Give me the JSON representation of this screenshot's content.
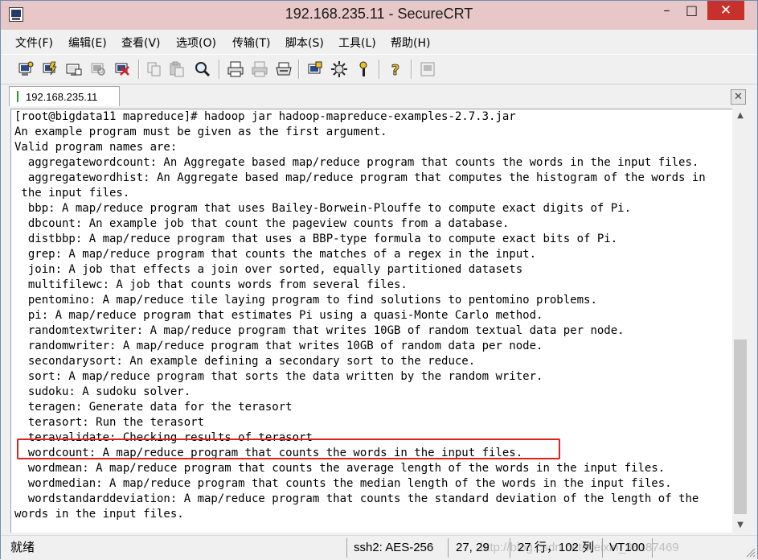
{
  "window": {
    "title": "192.168.235.11 - SecureCRT",
    "minimize_icon": "minimize-icon",
    "maximize_icon": "maximize-icon",
    "close_icon": "close-icon"
  },
  "menu": {
    "items": [
      "文件(F)",
      "编辑(E)",
      "查看(V)",
      "选项(O)",
      "传输(T)",
      "脚本(S)",
      "工具(L)",
      "帮助(H)"
    ]
  },
  "toolbar": {
    "icons": [
      "connect-icon",
      "quick-connect-icon",
      "connect-in-tab-icon",
      "reconnect-icon",
      "disconnect-icon",
      "copy-icon",
      "paste-icon",
      "find-icon",
      "print-icon",
      "print-selection-icon",
      "print-setup-icon",
      "session-options-icon",
      "global-options-icon",
      "keymap-icon",
      "help-icon",
      "log-icon"
    ]
  },
  "tabs": [
    {
      "label": "192.168.235.11",
      "active": true
    }
  ],
  "terminal": {
    "lines": [
      "[root@bigdata11 mapreduce]# hadoop jar hadoop-mapreduce-examples-2.7.3.jar",
      "An example program must be given as the first argument.",
      "Valid program names are:",
      "  aggregatewordcount: An Aggregate based map/reduce program that counts the words in the input files.",
      "  aggregatewordhist: An Aggregate based map/reduce program that computes the histogram of the words in",
      " the input files.",
      "  bbp: A map/reduce program that uses Bailey-Borwein-Plouffe to compute exact digits of Pi.",
      "  dbcount: An example job that count the pageview counts from a database.",
      "  distbbp: A map/reduce program that uses a BBP-type formula to compute exact bits of Pi.",
      "  grep: A map/reduce program that counts the matches of a regex in the input.",
      "  join: A job that effects a join over sorted, equally partitioned datasets",
      "  multifilewc: A job that counts words from several files.",
      "  pentomino: A map/reduce tile laying program to find solutions to pentomino problems.",
      "  pi: A map/reduce program that estimates Pi using a quasi-Monte Carlo method.",
      "  randomtextwriter: A map/reduce program that writes 10GB of random textual data per node.",
      "  randomwriter: A map/reduce program that writes 10GB of random data per node.",
      "  secondarysort: An example defining a secondary sort to the reduce.",
      "  sort: A map/reduce program that sorts the data written by the random writer.",
      "  sudoku: A sudoku solver.",
      "  teragen: Generate data for the terasort",
      "  terasort: Run the terasort",
      "  teravalidate: Checking results of terasort",
      "  wordcount: A map/reduce program that counts the words in the input files.",
      "  wordmean: A map/reduce program that counts the average length of the words in the input files.",
      "  wordmedian: A map/reduce program that counts the median length of the words in the input files.",
      "  wordstandarddeviation: A map/reduce program that counts the standard deviation of the length of the",
      "words in the input files."
    ],
    "highlight_color": "#e02020"
  },
  "status": {
    "ready": "就绪",
    "cipher": "ssh2: AES-256",
    "cursor": "27, 29",
    "rows_cols": "27 行，102 列",
    "terminal_type": "VT100",
    "watermark": "http://blog.csdn.net/weixin_38187469"
  },
  "colors": {
    "titlebar": "#e7c7c7",
    "close_button": "#c7312b",
    "terminal_bg": "#ffffff"
  }
}
